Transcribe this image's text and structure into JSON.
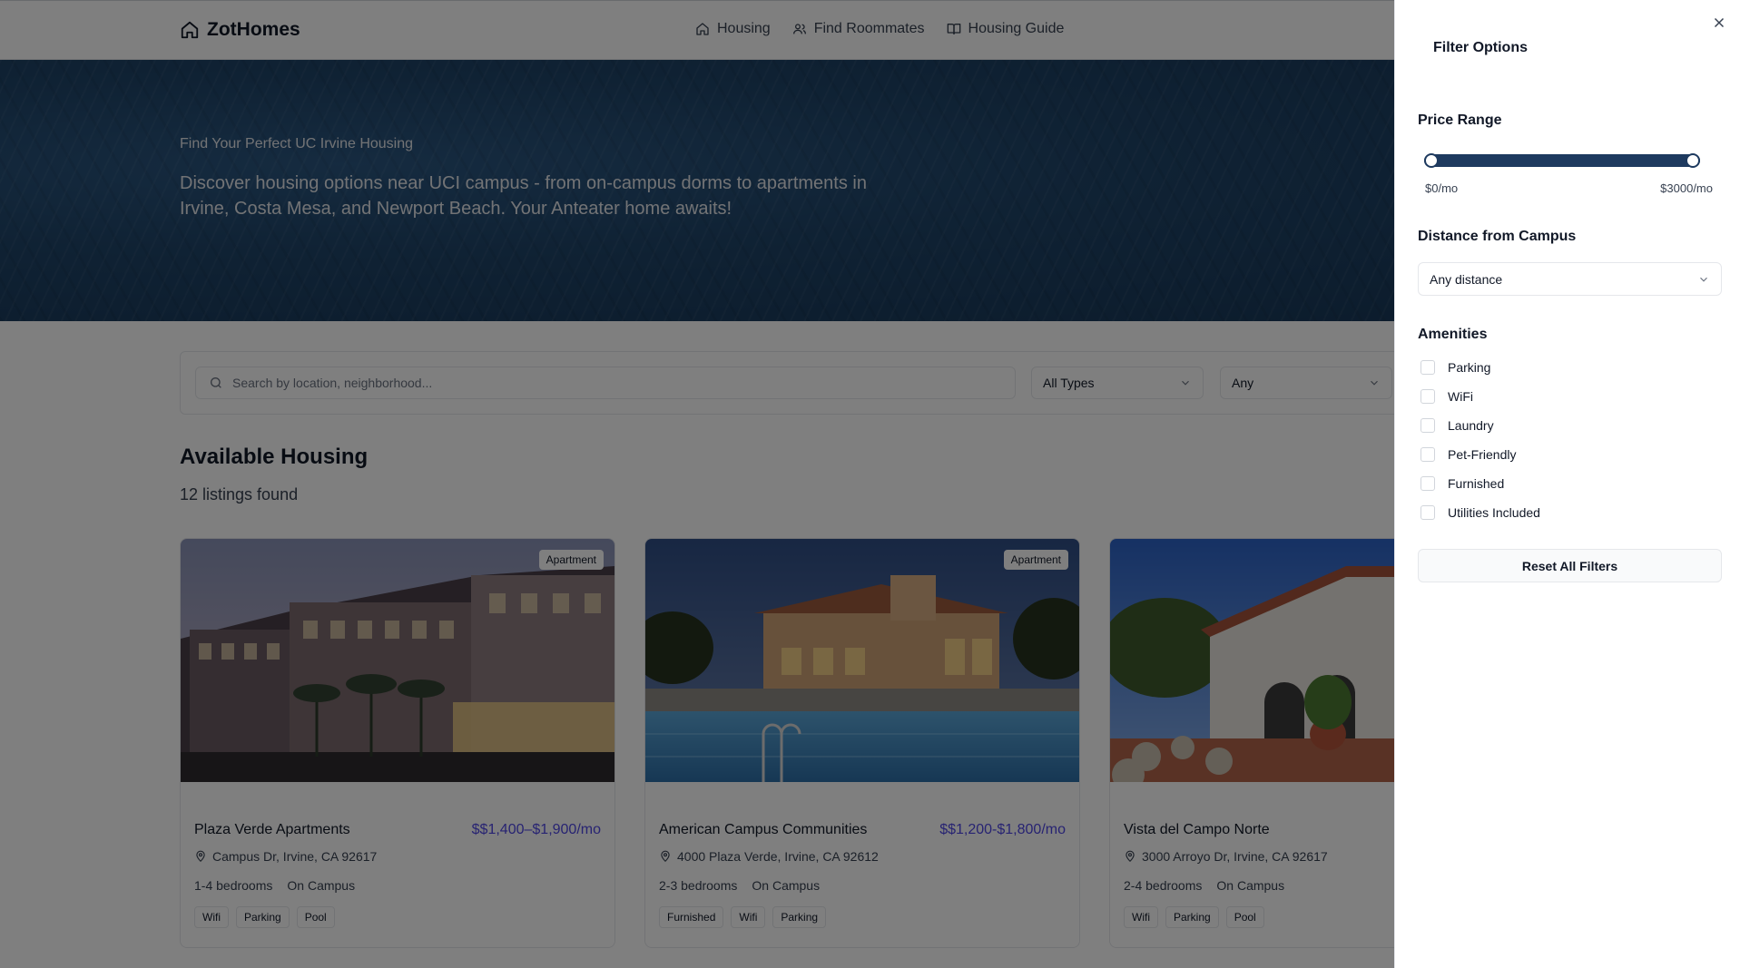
{
  "header": {
    "logo_text": "ZotHomes",
    "nav": [
      {
        "label": "Housing",
        "icon": "home-icon"
      },
      {
        "label": "Find Roommates",
        "icon": "users-icon"
      },
      {
        "label": "Housing Guide",
        "icon": "book-icon"
      }
    ]
  },
  "hero": {
    "kicker": "Find Your Perfect UC Irvine Housing",
    "description": "Discover housing options near UCI campus - from on-campus dorms to apartments in Irvine, Costa Mesa, and Newport Beach. Your Anteater home awaits!"
  },
  "search": {
    "placeholder": "Search by location, neighborhood...",
    "type_select": "All Types",
    "any_select": "Any"
  },
  "listings": {
    "title": "Available Housing",
    "count": "12 listings found",
    "cards": [
      {
        "badge": "Apartment",
        "name": "Plaza Verde Apartments",
        "price": "$$1,400–$1,900/mo",
        "address": "Campus Dr, Irvine, CA 92617",
        "bedrooms": "1-4 bedrooms",
        "location": "On Campus",
        "tags": [
          "Wifi",
          "Parking",
          "Pool"
        ]
      },
      {
        "badge": "Apartment",
        "name": "American Campus Communities",
        "price": "$$1,200-$1,800/mo",
        "address": "4000 Plaza Verde, Irvine, CA 92612",
        "bedrooms": "2-3 bedrooms",
        "location": "On Campus",
        "tags": [
          "Furnished",
          "Wifi",
          "Parking"
        ]
      },
      {
        "badge": "",
        "name": "Vista del Campo Norte",
        "price": "",
        "address": "3000 Arroyo Dr, Irvine, CA 92617",
        "bedrooms": "2-4 bedrooms",
        "location": "On Campus",
        "tags": [
          "Wifi",
          "Parking",
          "Pool"
        ]
      }
    ]
  },
  "filters": {
    "title": "Filter Options",
    "price_range": {
      "label": "Price Range",
      "min_label": "$0/mo",
      "max_label": "$3000/mo",
      "min_value": 0,
      "max_value": 3000
    },
    "distance": {
      "label": "Distance from Campus",
      "selected": "Any distance"
    },
    "amenities": {
      "label": "Amenities",
      "items": [
        "Parking",
        "WiFi",
        "Laundry",
        "Pet-Friendly",
        "Furnished",
        "Utilities Included"
      ]
    },
    "reset_label": "Reset All Filters"
  },
  "colors": {
    "accent": "#1e3a5f",
    "price": "#4f46e5",
    "hero": "#1f4468"
  }
}
